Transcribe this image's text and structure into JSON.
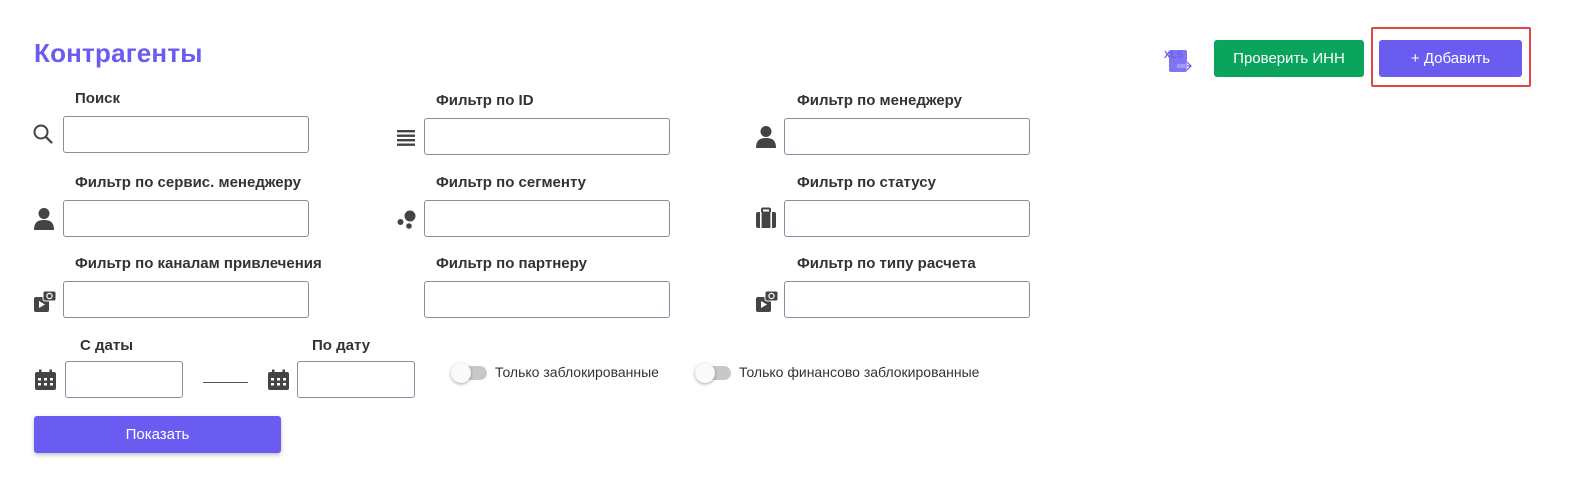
{
  "page": {
    "title": "Контрагенты"
  },
  "header": {
    "export_icon_text": "XLS",
    "check_inn_label": "Проверить ИНН",
    "add_label": "+ Добавить"
  },
  "filters": {
    "search": "Поиск",
    "by_id": "Фильтр по ID",
    "by_manager": "Фильтр по менеджеру",
    "by_service_manager": "Фильтр по сервис. менеджеру",
    "by_segment": "Фильтр по сегменту",
    "by_status": "Фильтр по статусу",
    "by_channels": "Фильтр по каналам привлечения",
    "by_partner": "Фильтр по партнеру",
    "by_payment_type": "Фильтр по типу расчета"
  },
  "dates": {
    "from_label": "С даты",
    "to_label": "По дату"
  },
  "toggles": {
    "blocked_only": "Только заблокированные",
    "fin_blocked_only": "Только финансово заблокированные"
  },
  "actions": {
    "show_label": "Показать"
  },
  "colors": {
    "accent": "#6a5cf0",
    "green": "#0aa45c",
    "highlight": "#e04646"
  }
}
